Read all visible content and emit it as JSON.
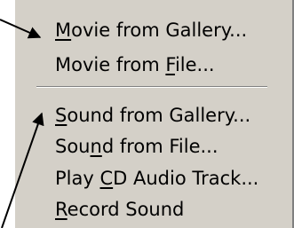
{
  "menu": {
    "items": [
      {
        "pre": "",
        "u": "M",
        "post": "ovie from Gallery..."
      },
      {
        "pre": "Movie from ",
        "u": "F",
        "post": "ile..."
      },
      {
        "pre": "",
        "u": "S",
        "post": "ound from Gallery..."
      },
      {
        "pre": "Sou",
        "u": "n",
        "post": "d from File..."
      },
      {
        "pre": "Play ",
        "u": "C",
        "post": "D Audio Track..."
      },
      {
        "pre": "",
        "u": "R",
        "post": "ecord Sound"
      }
    ]
  },
  "colors": {
    "menu_background": "#d4d0c8",
    "separator_dark": "#808080",
    "separator_light": "#ffffff",
    "arrow": "#000000"
  }
}
